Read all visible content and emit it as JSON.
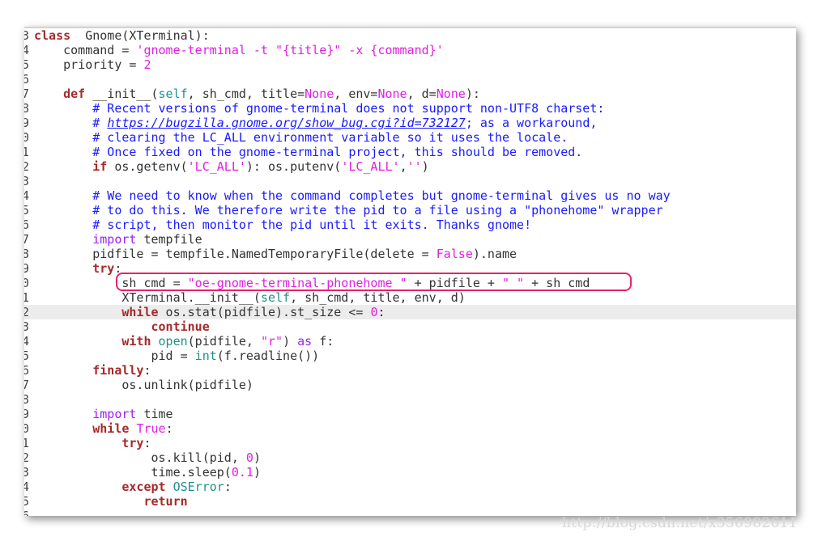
{
  "editor": {
    "current_line_index": 19,
    "annotation_color": "#e8226a",
    "lines": [
      {
        "n": "3",
        "t": [
          [
            "k",
            "class"
          ],
          [
            "",
            "  Gnome(XTerminal):"
          ]
        ]
      },
      {
        "n": "4",
        "t": [
          [
            "",
            "    command = "
          ],
          [
            "s",
            "'gnome-terminal -t \"{title}\" -x {command}'"
          ]
        ]
      },
      {
        "n": "5",
        "t": [
          [
            "",
            "    priority = "
          ],
          [
            "n",
            "2"
          ]
        ]
      },
      {
        "n": "6",
        "t": []
      },
      {
        "n": "7",
        "t": [
          [
            "",
            "    "
          ],
          [
            "k",
            "def"
          ],
          [
            "",
            " __init__("
          ],
          [
            "b",
            "self"
          ],
          [
            "",
            ", sh_cmd, title="
          ],
          [
            "n",
            "None"
          ],
          [
            "",
            ", env="
          ],
          [
            "n",
            "None"
          ],
          [
            "",
            ", d="
          ],
          [
            "n",
            "None"
          ],
          [
            "",
            "):"
          ]
        ]
      },
      {
        "n": "8",
        "t": [
          [
            "",
            "        "
          ],
          [
            "c",
            "# Recent versions of gnome-terminal does not support non-UTF8 charset:"
          ]
        ]
      },
      {
        "n": "9",
        "t": [
          [
            "",
            "        "
          ],
          [
            "c",
            "# "
          ],
          [
            "u",
            "https://bugzilla.gnome.org/show_bug.cgi?id=732127"
          ],
          [
            "c",
            "; as a workaround,"
          ]
        ]
      },
      {
        "n": "0",
        "t": [
          [
            "",
            "        "
          ],
          [
            "c",
            "# clearing the LC_ALL environment variable so it uses the locale."
          ]
        ]
      },
      {
        "n": "1",
        "t": [
          [
            "",
            "        "
          ],
          [
            "c",
            "# Once fixed on the gnome-terminal project, this should be removed."
          ]
        ]
      },
      {
        "n": "2",
        "t": [
          [
            "",
            "        "
          ],
          [
            "k",
            "if"
          ],
          [
            "",
            " os.getenv("
          ],
          [
            "s",
            "'LC_ALL'"
          ],
          [
            "",
            "): os.putenv("
          ],
          [
            "s",
            "'LC_ALL'"
          ],
          [
            "",
            ","
          ],
          [
            "s",
            "''"
          ],
          [
            "",
            ")"
          ]
        ]
      },
      {
        "n": "3",
        "t": []
      },
      {
        "n": "4",
        "t": [
          [
            "",
            "        "
          ],
          [
            "c",
            "# We need to know when the command completes but gnome-terminal gives us no way"
          ]
        ]
      },
      {
        "n": "5",
        "t": [
          [
            "",
            "        "
          ],
          [
            "c",
            "# to do this. We therefore write the pid to a file using a \"phonehome\" wrapper"
          ]
        ]
      },
      {
        "n": "6",
        "t": [
          [
            "",
            "        "
          ],
          [
            "c",
            "# script, then monitor the pid until it exits. Thanks gnome!"
          ]
        ]
      },
      {
        "n": "7",
        "t": [
          [
            "",
            "        "
          ],
          [
            "p",
            "import"
          ],
          [
            "",
            " tempfile"
          ]
        ]
      },
      {
        "n": "8",
        "t": [
          [
            "",
            "        pidfile = tempfile.NamedTemporaryFile(delete = "
          ],
          [
            "n",
            "False"
          ],
          [
            "",
            ").name"
          ]
        ]
      },
      {
        "n": "9",
        "t": [
          [
            "",
            "        "
          ],
          [
            "k",
            "try"
          ],
          [
            "",
            ":"
          ]
        ]
      },
      {
        "n": "0",
        "t": [
          [
            "",
            "            sh_cmd = "
          ],
          [
            "s",
            "\"oe-gnome-terminal-phonehome \""
          ],
          [
            "",
            " + pidfile + "
          ],
          [
            "s",
            "\" \""
          ],
          [
            "",
            " + sh_cmd"
          ]
        ]
      },
      {
        "n": "1",
        "t": [
          [
            "",
            "            XTerminal.__init__("
          ],
          [
            "b",
            "self"
          ],
          [
            "",
            ", sh_cmd, title, env, d)"
          ]
        ]
      },
      {
        "n": "2",
        "t": [
          [
            "",
            "            "
          ],
          [
            "k",
            "while"
          ],
          [
            "",
            " os.stat(pidfile).st_size <= "
          ],
          [
            "n",
            "0"
          ],
          [
            "",
            ":"
          ]
        ]
      },
      {
        "n": "3",
        "t": [
          [
            "",
            "                "
          ],
          [
            "k",
            "continue"
          ]
        ]
      },
      {
        "n": "4",
        "t": [
          [
            "",
            "            "
          ],
          [
            "k",
            "with"
          ],
          [
            "",
            " "
          ],
          [
            "b",
            "open"
          ],
          [
            "",
            "(pidfile, "
          ],
          [
            "s",
            "\"r\""
          ],
          [
            "",
            ") "
          ],
          [
            "p",
            "as"
          ],
          [
            "",
            " f:"
          ]
        ]
      },
      {
        "n": "5",
        "t": [
          [
            "",
            "                pid = "
          ],
          [
            "b",
            "int"
          ],
          [
            "",
            "(f.readline())"
          ]
        ]
      },
      {
        "n": "6",
        "t": [
          [
            "",
            "        "
          ],
          [
            "k",
            "finally"
          ],
          [
            "",
            ":"
          ]
        ]
      },
      {
        "n": "7",
        "t": [
          [
            "",
            "            os.unlink(pidfile)"
          ]
        ]
      },
      {
        "n": "8",
        "t": []
      },
      {
        "n": "9",
        "t": [
          [
            "",
            "        "
          ],
          [
            "p",
            "import"
          ],
          [
            "",
            " time"
          ]
        ]
      },
      {
        "n": "0",
        "t": [
          [
            "",
            "        "
          ],
          [
            "k",
            "while"
          ],
          [
            "",
            " "
          ],
          [
            "n",
            "True"
          ],
          [
            "",
            ":"
          ]
        ]
      },
      {
        "n": "1",
        "t": [
          [
            "",
            "            "
          ],
          [
            "k",
            "try"
          ],
          [
            "",
            ":"
          ]
        ]
      },
      {
        "n": "2",
        "t": [
          [
            "",
            "                os.kill(pid, "
          ],
          [
            "n",
            "0"
          ],
          [
            "",
            ")"
          ]
        ]
      },
      {
        "n": "3",
        "t": [
          [
            "",
            "                time.sleep("
          ],
          [
            "n",
            "0.1"
          ],
          [
            "",
            ")"
          ]
        ]
      },
      {
        "n": "4",
        "t": [
          [
            "",
            "            "
          ],
          [
            "k",
            "except"
          ],
          [
            "",
            " "
          ],
          [
            "b",
            "OSError"
          ],
          [
            "",
            ":"
          ]
        ]
      },
      {
        "n": "5",
        "t": [
          [
            "",
            "               "
          ],
          [
            "k",
            "return"
          ]
        ]
      },
      {
        "n": "6",
        "t": []
      }
    ]
  },
  "watermark": "http://blog.csdn.net/x356982611"
}
